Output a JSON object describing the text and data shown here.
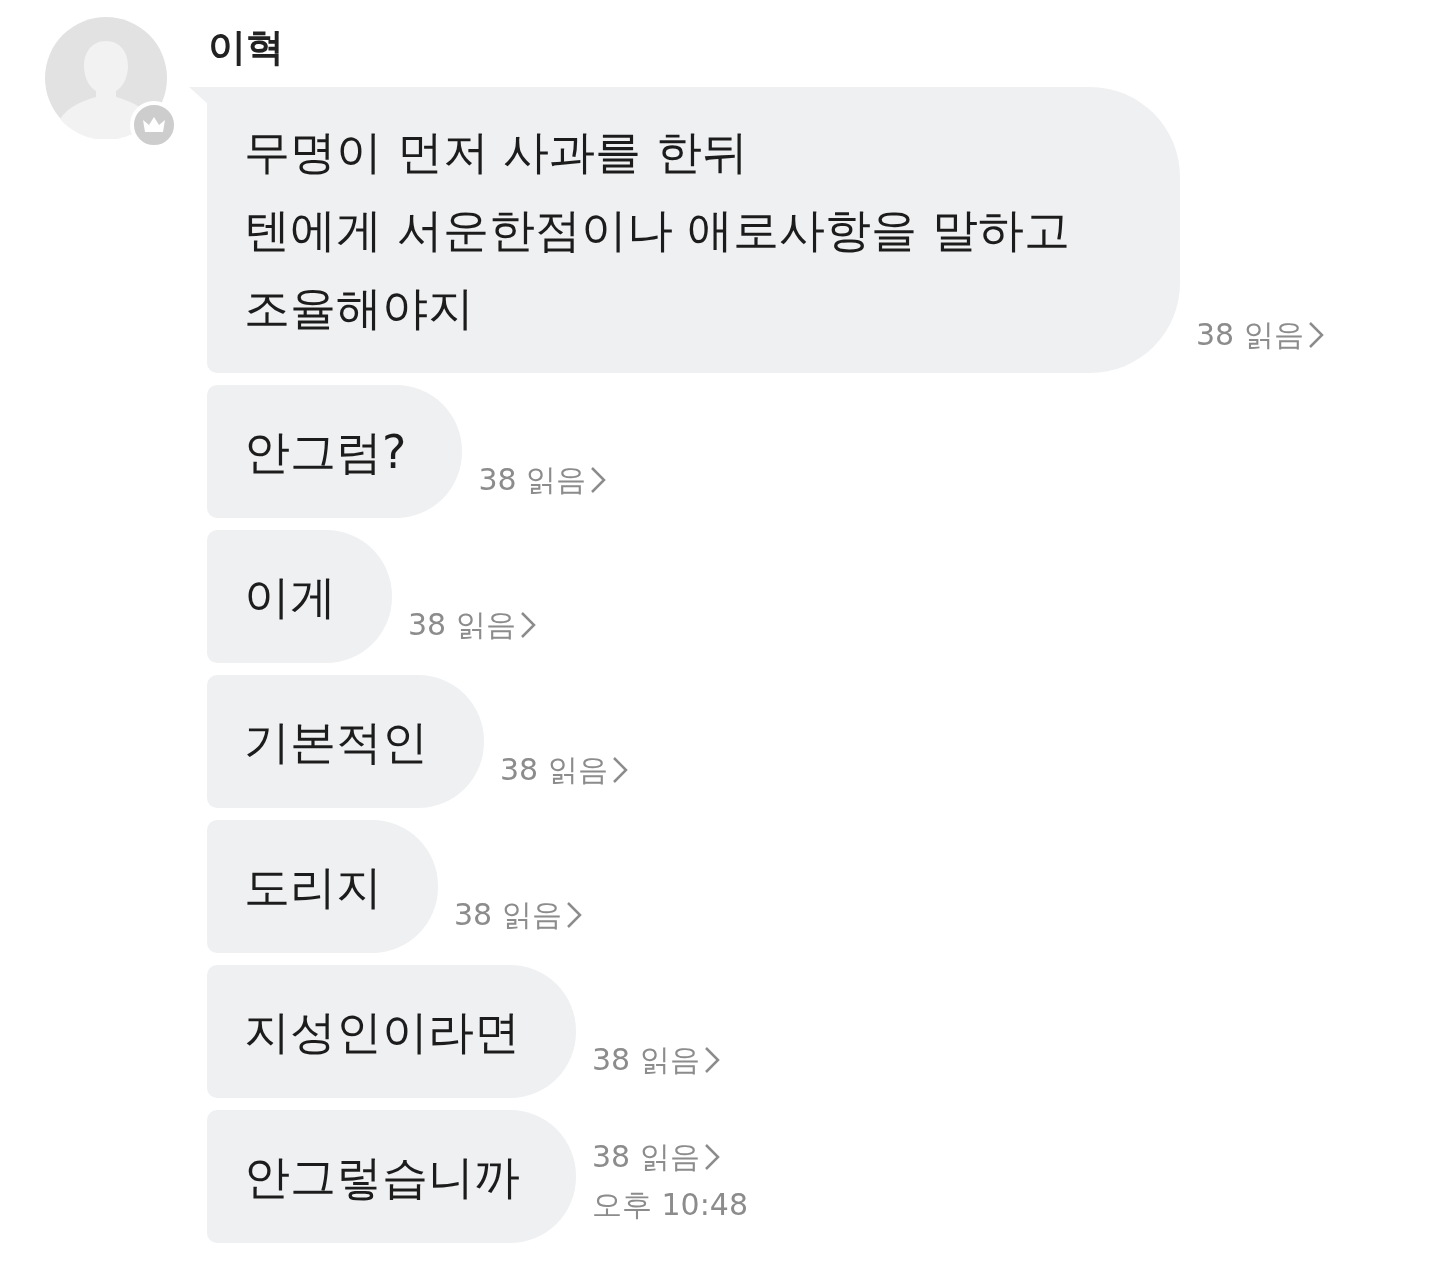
{
  "sender": {
    "name": "이혁"
  },
  "messages": [
    {
      "text": "무명이 먼저 사과를 한뒤\n텐에게 서운한점이나 애로사항을 말하고\n조율해야지",
      "read": "38 읽음"
    },
    {
      "text": "안그럼?",
      "read": "38 읽음"
    },
    {
      "text": "이게",
      "read": "38 읽음"
    },
    {
      "text": "기본적인",
      "read": "38 읽음"
    },
    {
      "text": "도리지",
      "read": "38 읽음"
    },
    {
      "text": "지성인이라면",
      "read": "38 읽음"
    },
    {
      "text": "안그렇습니까",
      "read": "38 읽음",
      "time": "오후 10:48"
    }
  ]
}
